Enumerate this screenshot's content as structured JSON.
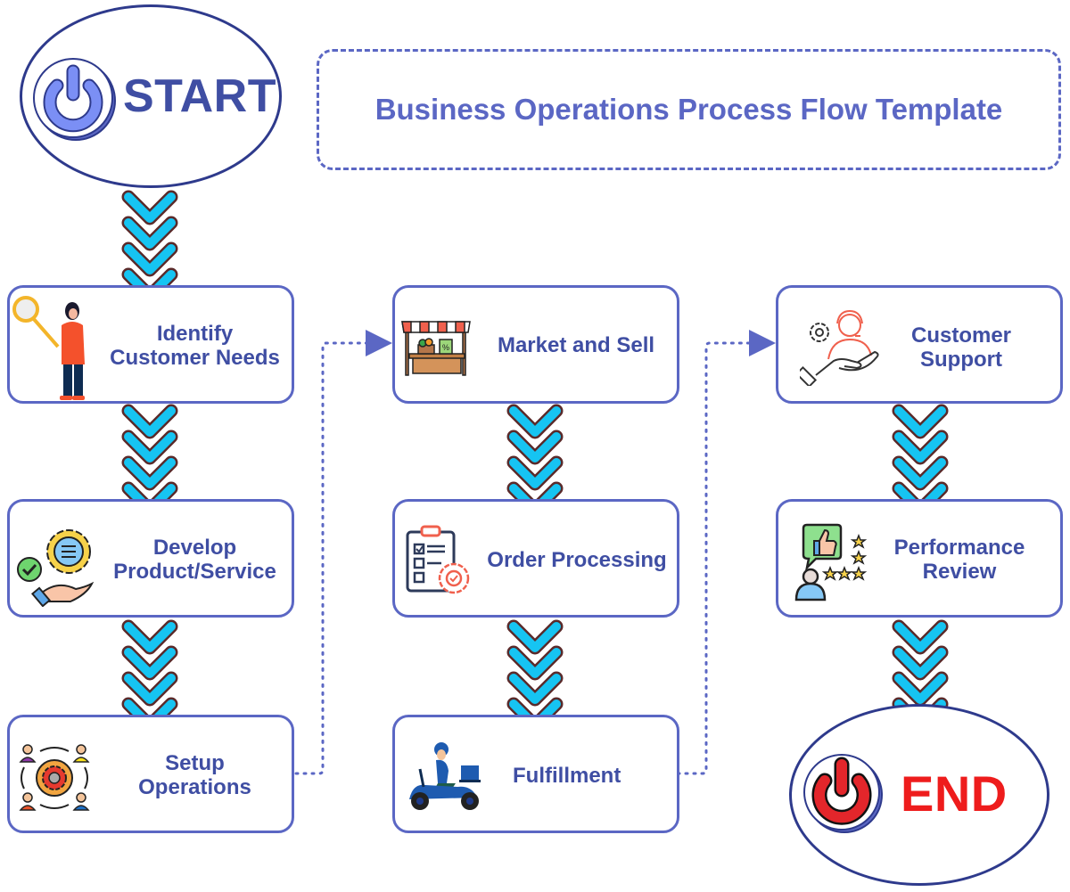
{
  "title": "Business Operations Process Flow Template",
  "start": {
    "label": "START",
    "icon": "power-icon",
    "color": "#3f4ea3"
  },
  "end": {
    "label": "END",
    "icon": "power-icon",
    "color": "#ee1c1c"
  },
  "colors": {
    "accent": "#5b67c4",
    "text": "#3f4ea3",
    "chevron_fill": "#16c4f2",
    "chevron_outline": "#5a2a2a",
    "outline_dark": "#2e3a8c"
  },
  "columns": [
    {
      "steps": [
        {
          "label_lines": [
            "Identify",
            "Customer Needs"
          ],
          "icon": "person-magnifier-icon"
        },
        {
          "label_lines": [
            "Develop",
            "Product/Service"
          ],
          "icon": "gear-chat-hand-icon"
        },
        {
          "label_lines": [
            "Setup",
            "Operations"
          ],
          "icon": "team-gear-cycle-icon"
        }
      ]
    },
    {
      "steps": [
        {
          "label_lines": [
            "Market and Sell"
          ],
          "icon": "market-stall-icon"
        },
        {
          "label_lines": [
            "Order Processing"
          ],
          "icon": "clipboard-gear-icon"
        },
        {
          "label_lines": [
            "Fulfillment"
          ],
          "icon": "delivery-scooter-icon"
        }
      ]
    },
    {
      "steps": [
        {
          "label_lines": [
            "Customer",
            "Support"
          ],
          "icon": "support-agent-hand-icon"
        },
        {
          "label_lines": [
            "Performance",
            "Review"
          ],
          "icon": "rating-feedback-icon"
        }
      ]
    }
  ],
  "connectors": [
    {
      "from": "Setup Operations",
      "to": "Market and Sell",
      "style": "dotted-arrow"
    },
    {
      "from": "Fulfillment",
      "to": "Customer Support",
      "style": "dotted-arrow"
    }
  ]
}
